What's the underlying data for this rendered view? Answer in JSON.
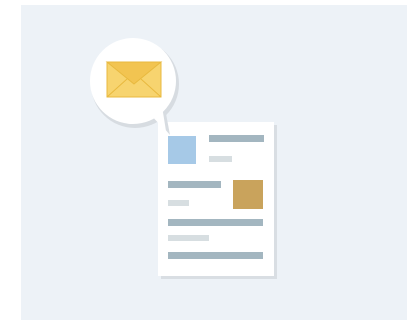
{
  "illustration": {
    "icon": "email-newsletter-document-icon",
    "colors": {
      "background": "#edf2f7",
      "paper": "#ffffff",
      "paper_shadow": "#d9dee3",
      "bubble": "#ffffff",
      "bubble_shadow": "#d7dce1",
      "envelope_body": "#f7d46f",
      "envelope_flap": "#f2c451",
      "envelope_outline": "#e8b93f",
      "image_blue": "#a6c9e7",
      "image_tan": "#c9a35c",
      "text_dark": "#a3b6c0",
      "text_light": "#d7dee1"
    }
  }
}
